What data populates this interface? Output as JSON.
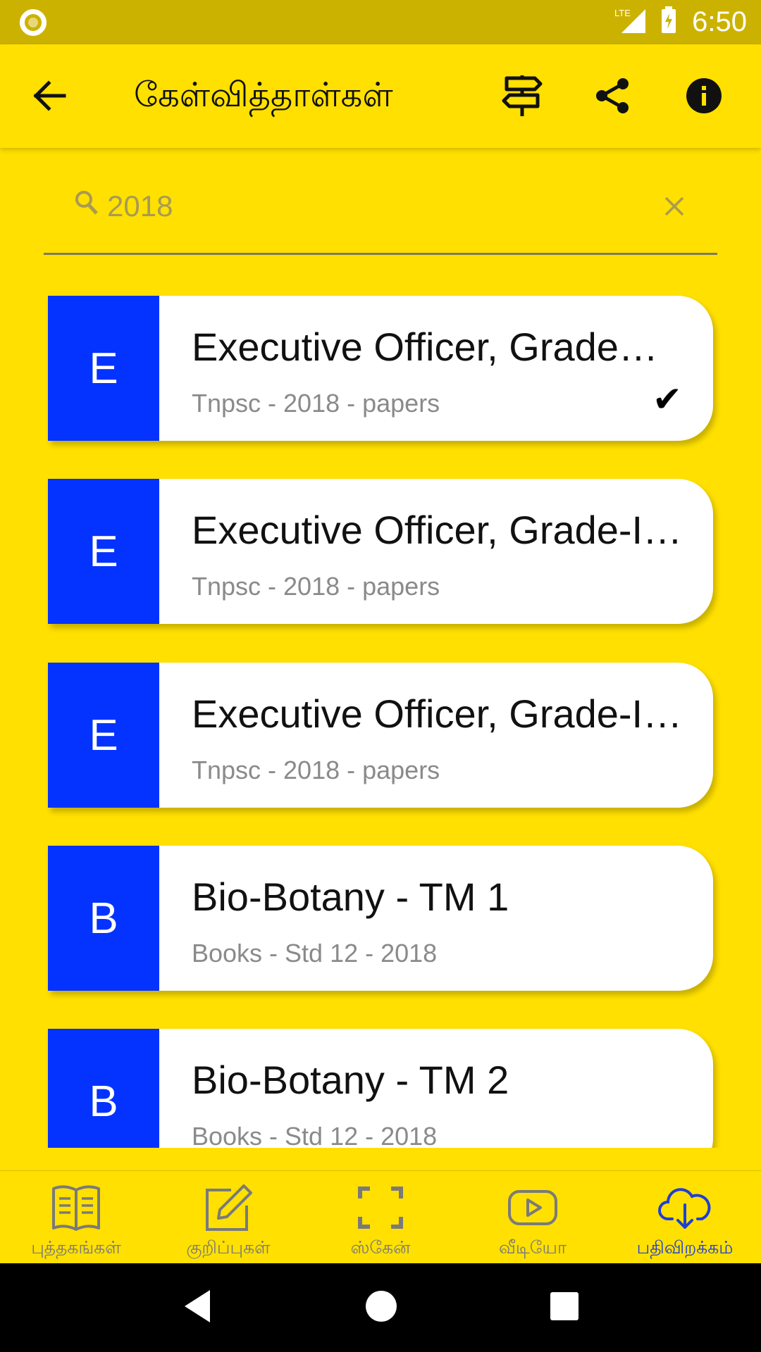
{
  "status_bar": {
    "time": "6:50",
    "network": "LTE",
    "icons": [
      "record-icon",
      "signal-icon",
      "battery-charging-icon"
    ]
  },
  "app_bar": {
    "title": "கேள்வித்தாள்கள்",
    "icons": [
      "back-arrow-icon",
      "signpost-icon",
      "share-icon",
      "info-icon"
    ]
  },
  "search": {
    "value": "2018",
    "placeholder": "",
    "icons": [
      "search-icon",
      "clear-icon"
    ]
  },
  "items": [
    {
      "letter": "E",
      "title": "Executive Officer, Grade…",
      "subtitle": "Tnpsc - 2018 - papers",
      "checked": true
    },
    {
      "letter": "E",
      "title": "Executive Officer, Grade-I…",
      "subtitle": "Tnpsc - 2018 - papers",
      "checked": false
    },
    {
      "letter": "E",
      "title": "Executive Officer, Grade-I…",
      "subtitle": "Tnpsc - 2018 - papers",
      "checked": false
    },
    {
      "letter": "B",
      "title": "Bio-Botany - TM 1",
      "subtitle": "Books - Std 12 - 2018",
      "checked": false
    },
    {
      "letter": "B",
      "title": "Bio-Botany - TM 2",
      "subtitle": "Books - Std 12 - 2018",
      "checked": false
    }
  ],
  "check_mark": "✔",
  "bottom_nav": [
    {
      "label": "புத்தகங்கள்",
      "icon": "book-icon",
      "active": false
    },
    {
      "label": "குறிப்புகள்",
      "icon": "edit-icon",
      "active": false
    },
    {
      "label": "ஸ்கேன்",
      "icon": "scan-icon",
      "active": false
    },
    {
      "label": "வீடியோ",
      "icon": "video-icon",
      "active": false
    },
    {
      "label": "பதிவிறக்கம்",
      "icon": "cloud-download-icon",
      "active": true
    }
  ],
  "colors": {
    "background": "#FFE000",
    "status_bar": "#CCB200",
    "accent": "#0433FF",
    "active_nav": "#1F3FD6",
    "inactive_nav": "#7A7A7A"
  }
}
